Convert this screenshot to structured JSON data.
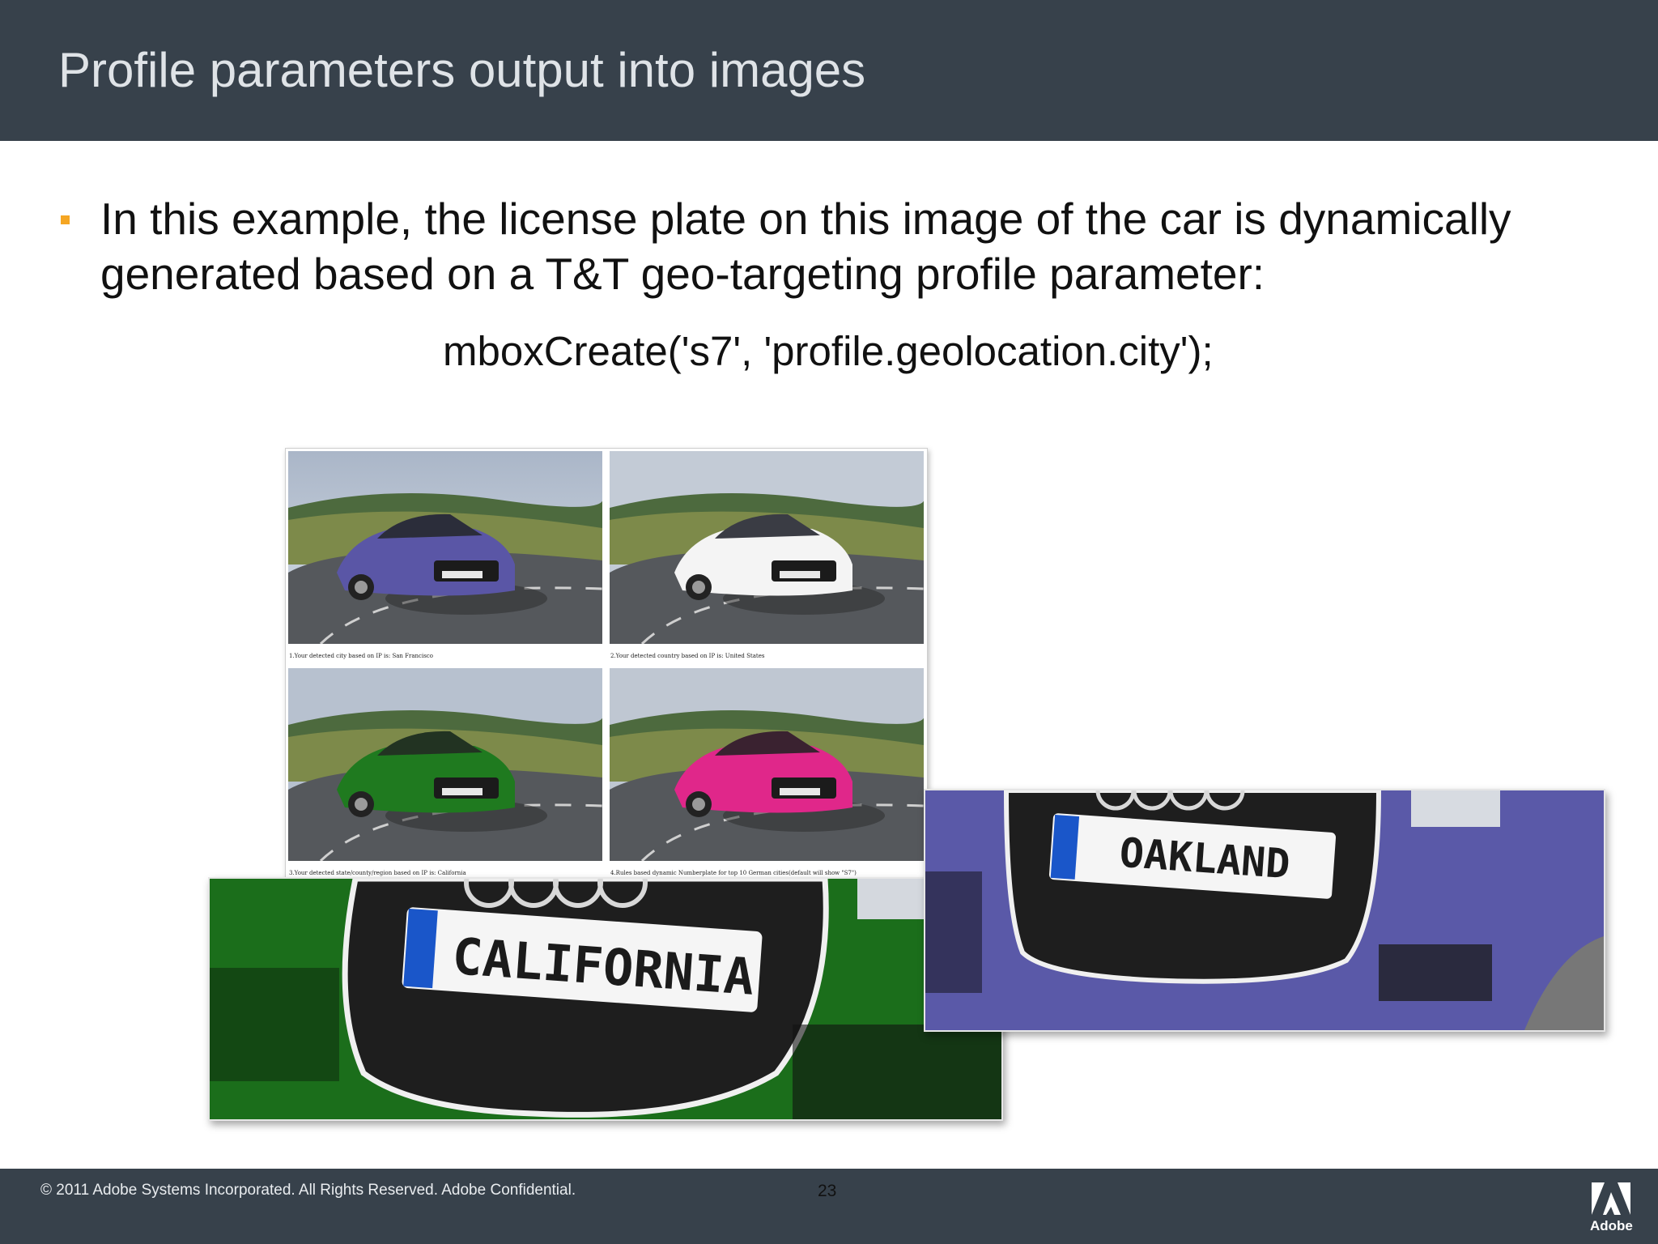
{
  "header": {
    "title": "Profile parameters output into images"
  },
  "bullet": {
    "text": "In this example, the license plate on this image of the car is dynamically generated based on a T&T geo-targeting profile parameter:"
  },
  "code": {
    "line": "mboxCreate('s7', 'profile.geolocation.city');"
  },
  "grid": {
    "cells": [
      {
        "car_color": "#5a56a6",
        "plate": "",
        "caption": "1.Your detected city based on IP is: San Francisco"
      },
      {
        "car_color": "#f4f4f4",
        "plate": "",
        "caption": "2.Your detected country based on IP is: United States"
      },
      {
        "car_color": "#1f7a1f",
        "plate": "",
        "caption": "3.Your detected state/county/region based on IP is: California"
      },
      {
        "car_color": "#e0278a",
        "plate": "",
        "caption": "4.Rules based dynamic Numberplate for top 10 German cities(default will show \"S7\")"
      }
    ]
  },
  "zooms": {
    "green": {
      "plate": "CALIFORNIA",
      "color": "#1b6e1b"
    },
    "purple": {
      "plate": "OAKLAND",
      "color": "#5a59a8"
    }
  },
  "footer": {
    "copyright": "© 2011 Adobe Systems Incorporated.  All Rights Reserved.  Adobe Confidential.",
    "page_number": "23",
    "logo_word": "Adobe"
  }
}
